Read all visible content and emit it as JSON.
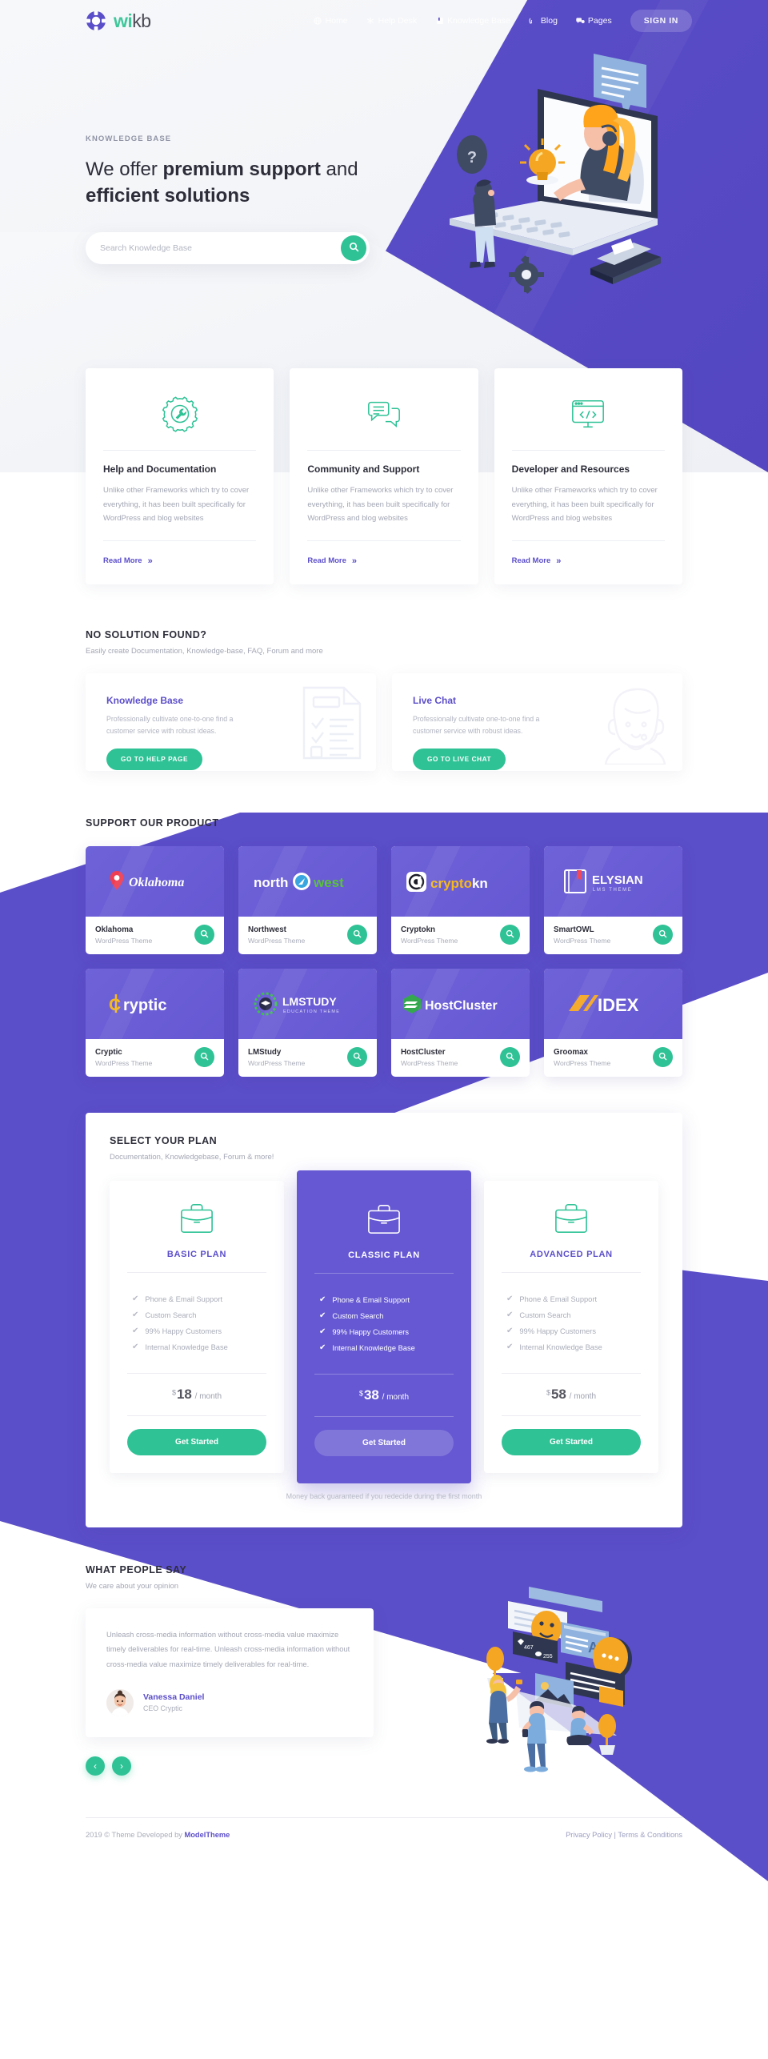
{
  "brand": {
    "name_first": "wi",
    "name_second": "kb",
    "logo_icon": "lifebuoy-icon"
  },
  "nav": {
    "items": [
      {
        "label": "Home",
        "icon": "globe-icon"
      },
      {
        "label": "Help Desk",
        "icon": "asterisk-icon"
      },
      {
        "label": "Knowledge Base",
        "icon": "book-icon"
      },
      {
        "label": "Blog",
        "icon": "rss-icon"
      },
      {
        "label": "Pages",
        "icon": "comments-icon"
      }
    ],
    "signin_label": "SIGN IN"
  },
  "hero": {
    "eyebrow": "KNOWLEDGE BASE",
    "title_part1": "We offer ",
    "title_bold1": "premium support",
    "title_part2": " and",
    "title_bold2": "efficient solutions",
    "search_placeholder": "Search Knowledge Base",
    "search_value": "",
    "search_icon": "search-icon"
  },
  "features": [
    {
      "icon": "gear-wrench-icon",
      "title": "Help and Documentation",
      "text": "Unlike other Frameworks which try to cover everything, it has been built specifically for WordPress and blog websites",
      "link": "Read More"
    },
    {
      "icon": "chat-bubbles-icon",
      "title": "Community and Support",
      "text": "Unlike other Frameworks which try to cover everything, it has been built specifically for WordPress and blog websites",
      "link": "Read More"
    },
    {
      "icon": "code-monitor-icon",
      "title": "Developer and Resources",
      "text": "Unlike other Frameworks which try to cover everything, it has been built specifically for WordPress and blog websites",
      "link": "Read More"
    }
  ],
  "no_solution": {
    "title": "NO SOLUTION FOUND?",
    "subtitle": "Easily create Documentation, Knowledge-base, FAQ, Forum and more",
    "cards": [
      {
        "title": "Knowledge Base",
        "text": "Professionally cultivate one-to-one find a customer service with robust ideas.",
        "button": "GO TO HELP PAGE",
        "art": "checklist-document-icon"
      },
      {
        "title": "Live Chat",
        "text": "Professionally cultivate one-to-one find a customer service with robust ideas.",
        "button": "GO TO LIVE CHAT",
        "art": "support-agent-icon"
      }
    ]
  },
  "products": {
    "title": "SUPPORT OUR PRODUCT",
    "items": [
      {
        "logo_text": "Oklahoma",
        "logo_style": "oklahoma",
        "name": "Oklahoma",
        "subtitle": "WordPress Theme",
        "action_icon": "search-icon"
      },
      {
        "logo_text": "north west",
        "logo_style": "northwest",
        "name": "Northwest",
        "subtitle": "WordPress Theme",
        "action_icon": "search-icon"
      },
      {
        "logo_text": "cryptokn",
        "logo_style": "cryptokn",
        "name": "Cryptokn",
        "subtitle": "WordPress Theme",
        "action_icon": "search-icon"
      },
      {
        "logo_text": "ELYSIAN",
        "logo_style": "elysian",
        "name": "SmartOWL",
        "subtitle": "WordPress Theme",
        "action_icon": "search-icon",
        "logo_sub": "LMS THEME"
      },
      {
        "logo_text": "ryptic",
        "logo_style": "cryptic",
        "name": "Cryptic",
        "subtitle": "WordPress Theme",
        "action_icon": "search-icon"
      },
      {
        "logo_text": "LMSTUDY",
        "logo_style": "lmstudy",
        "name": "LMStudy",
        "subtitle": "WordPress Theme",
        "action_icon": "search-icon",
        "logo_sub": "EDUCATION THEME"
      },
      {
        "logo_text": "HostCluster",
        "logo_style": "hostcluster",
        "name": "HostCluster",
        "subtitle": "WordPress Theme",
        "action_icon": "search-icon"
      },
      {
        "logo_text": "IDEX",
        "logo_style": "idex",
        "name": "Groomax",
        "subtitle": "WordPress Theme",
        "action_icon": "search-icon"
      }
    ]
  },
  "pricing": {
    "title": "SELECT YOUR PLAN",
    "subtitle": "Documentation, Knowledgebase, Forum & more!",
    "guarantee": "Money back guaranteed if you redecide during the first month",
    "plans": [
      {
        "icon": "briefcase-icon",
        "name": "BASIC PLAN",
        "features": [
          "Phone & Email Support",
          "Custom Search",
          "99% Happy Customers",
          "Internal Knowledge Base"
        ],
        "currency": "$",
        "amount": "18",
        "period": "/ month",
        "cta": "Get Started",
        "featured": false
      },
      {
        "icon": "briefcase-icon",
        "name": "CLASSIC PLAN",
        "features": [
          "Phone & Email Support",
          "Custom Search",
          "99% Happy Customers",
          "Internal Knowledge Base"
        ],
        "currency": "$",
        "amount": "38",
        "period": "/ month",
        "cta": "Get Started",
        "featured": true
      },
      {
        "icon": "briefcase-icon",
        "name": "ADVANCED PLAN",
        "features": [
          "Phone & Email Support",
          "Custom Search",
          "99% Happy Customers",
          "Internal Knowledge Base"
        ],
        "currency": "$",
        "amount": "58",
        "period": "/ month",
        "cta": "Get Started",
        "featured": false
      }
    ]
  },
  "testimonials": {
    "title": "WHAT PEOPLE SAY",
    "subtitle": "We care about your opinion",
    "quote": "Unleash cross-media information without cross-media value maximize timely deliverables for real-time. Unleash cross-media information without cross-media value maximize timely deliverables for real-time.",
    "author": "Vanessa Daniel",
    "role": "CEO Cryptic",
    "prev_icon": "chevron-left-icon",
    "next_icon": "chevron-right-icon"
  },
  "footer": {
    "copyright_prefix": "2019 © Theme Developed by ",
    "copyright_brand": "ModelTheme",
    "links": "Privacy Policy | Terms & Conditions"
  },
  "colors": {
    "purple": "#5b4ec9",
    "purple_light": "#6558d2",
    "green": "#2fc295",
    "text_dark": "#2d2d3a",
    "text_muted": "#a3a6b4"
  }
}
